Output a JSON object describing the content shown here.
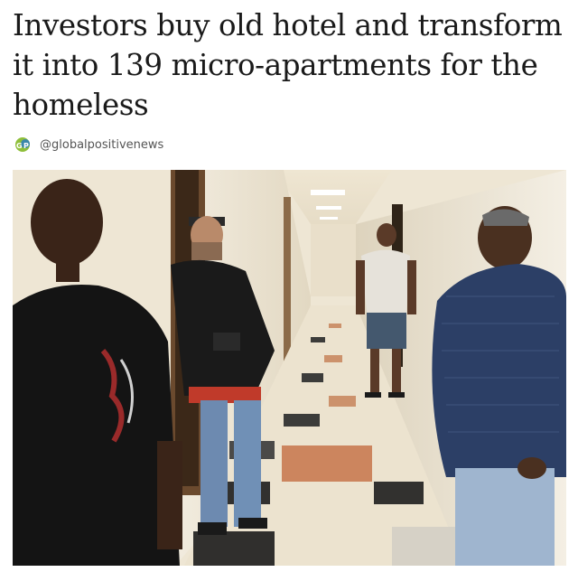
{
  "article": {
    "headline_lines": [
      "Investors buy old hotel and transform",
      "it into 139 micro-apartments for the",
      "homeless"
    ],
    "source_handle": "@globalpositivenews",
    "source_logo": "GP-logo"
  },
  "photo": {
    "subject": "hallway-with-four-men"
  }
}
